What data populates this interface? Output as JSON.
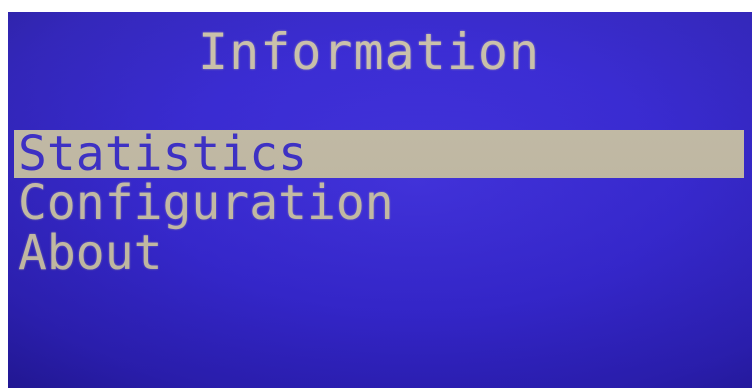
{
  "screen": {
    "title": "Information"
  },
  "menu": {
    "items": [
      {
        "label": "Statistics",
        "selected": true
      },
      {
        "label": "Configuration",
        "selected": false
      },
      {
        "label": "About",
        "selected": false
      }
    ]
  },
  "colors": {
    "background": "#3526d4",
    "text": "#c9c0a8",
    "highlight": "#c4bca6",
    "highlight_text": "#3a2dc8"
  }
}
